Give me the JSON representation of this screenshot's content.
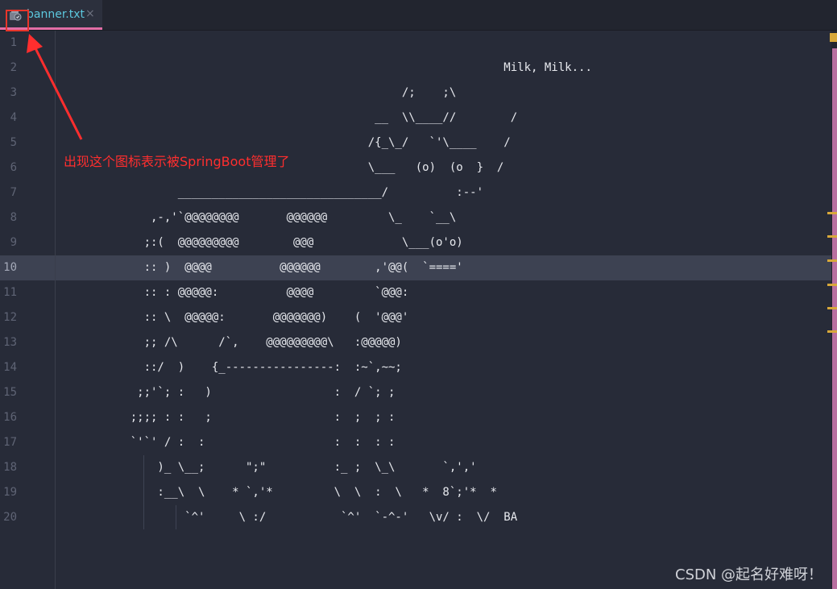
{
  "tab": {
    "filename": "banner.txt",
    "close_symbol": "×",
    "icon": "text-file-icon"
  },
  "editor": {
    "current_line": 10,
    "line_numbers": [
      "1",
      "2",
      "3",
      "4",
      "5",
      "6",
      "7",
      "8",
      "9",
      "10",
      "11",
      "12",
      "13",
      "14",
      "15",
      "16",
      "17",
      "18",
      "19",
      "20"
    ],
    "lines": [
      "",
      "                                                                  Milk, Milk...",
      "                                                   /;    ;\\",
      "                                               __  \\\\____//        /",
      "                                              /{_\\_/   `'\\____    /",
      "                                              \\___   (o)  (o  }  /",
      "                  ______________________________/          :--'",
      "              ,-,'`@@@@@@@@       @@@@@@         \\_    `__\\",
      "             ;:(  @@@@@@@@@        @@@             \\___(o'o)",
      "             :: )  @@@@          @@@@@@        ,'@@(  `===='",
      "             :: : @@@@@:          @@@@         `@@@:",
      "             :: \\  @@@@@:       @@@@@@@)    (  '@@@'",
      "             ;; /\\      /`,    @@@@@@@@@\\   :@@@@@)",
      "             ::/  )    {_----------------:  :~`,~~;",
      "            ;;'`; :   )                  :  / `; ;",
      "           ;;;; : :   ;                  :  ;  ; :",
      "           `'`' / :  :                   :  :  : :",
      "               )_ \\__;      \";\"          :_ ;  \\_\\       `,','",
      "               :__\\  \\    * `,'*         \\  \\  :  \\   *  8`;'*  *",
      "                   `^'     \\ :/           `^'  `-^-'   \\v/ :  \\/  BA"
    ]
  },
  "annotation": {
    "text": "出现这个图标表示被SpringBoot管理了",
    "color": "#ff2e2e"
  },
  "watermark": {
    "text": "CSDN @起名好难呀！"
  },
  "colors": {
    "background": "#272b38",
    "tab_underline": "#e26ea6",
    "tab_text": "#5cc8df",
    "annotation": "#ff2e2e",
    "scroll_accent": "#b86fa0",
    "marker": "#d8a83a"
  }
}
